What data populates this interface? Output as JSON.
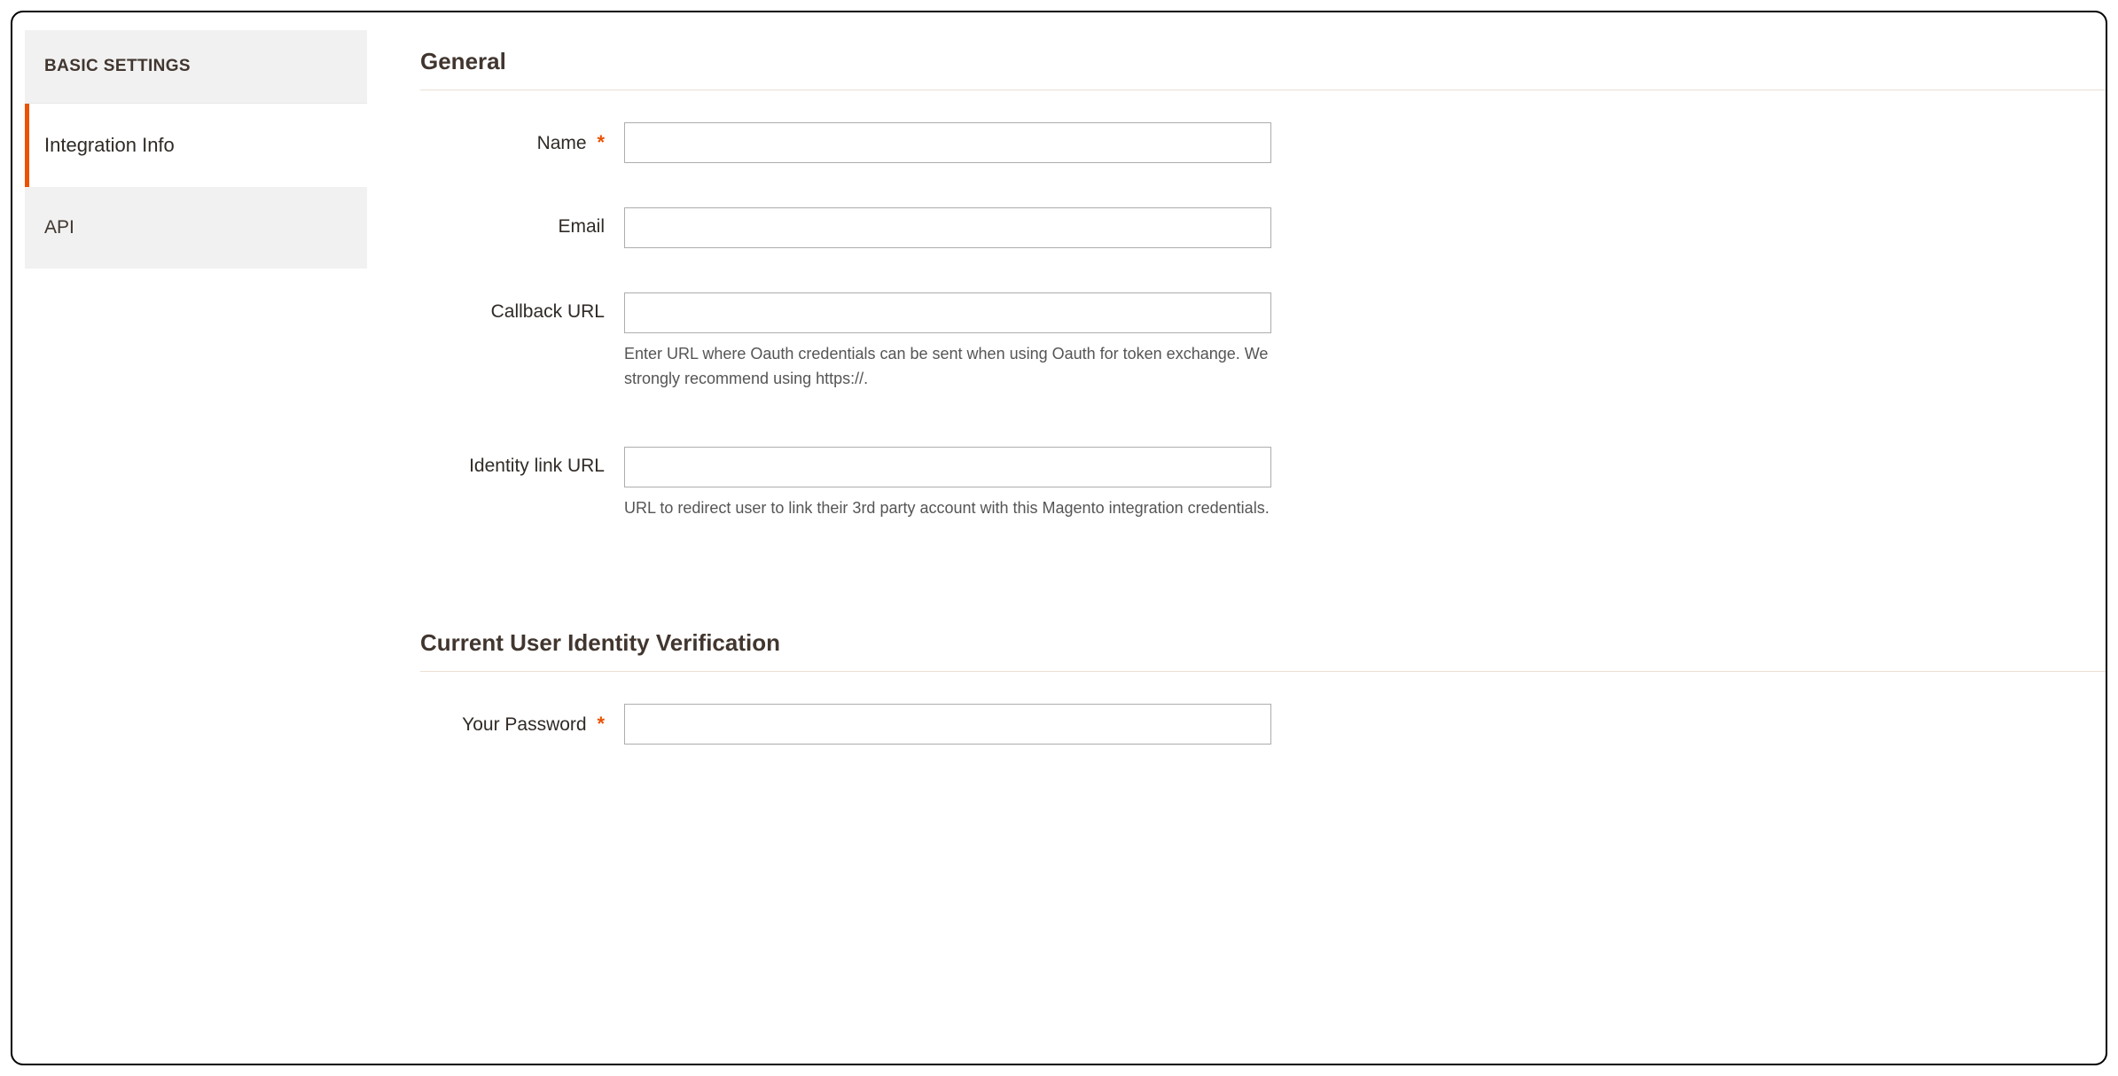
{
  "sidebar": {
    "header": "BASIC SETTINGS",
    "items": [
      {
        "label": "Integration Info",
        "active": true
      },
      {
        "label": "API",
        "active": false
      }
    ]
  },
  "main": {
    "sections": [
      {
        "title": "General",
        "fields": {
          "name": {
            "label": "Name",
            "required": true,
            "value": "",
            "help": ""
          },
          "email": {
            "label": "Email",
            "required": false,
            "value": "",
            "help": ""
          },
          "callback_url": {
            "label": "Callback URL",
            "required": false,
            "value": "",
            "help": "Enter URL where Oauth credentials can be sent when using Oauth for token exchange. We strongly recommend using https://."
          },
          "identity_link": {
            "label": "Identity link URL",
            "required": false,
            "value": "",
            "help": "URL to redirect user to link their 3rd party account with this Magento integration credentials."
          }
        }
      },
      {
        "title": "Current User Identity Verification",
        "fields": {
          "password": {
            "label": "Your Password",
            "required": true,
            "value": "",
            "help": ""
          }
        }
      }
    ]
  },
  "required_marker": "*"
}
